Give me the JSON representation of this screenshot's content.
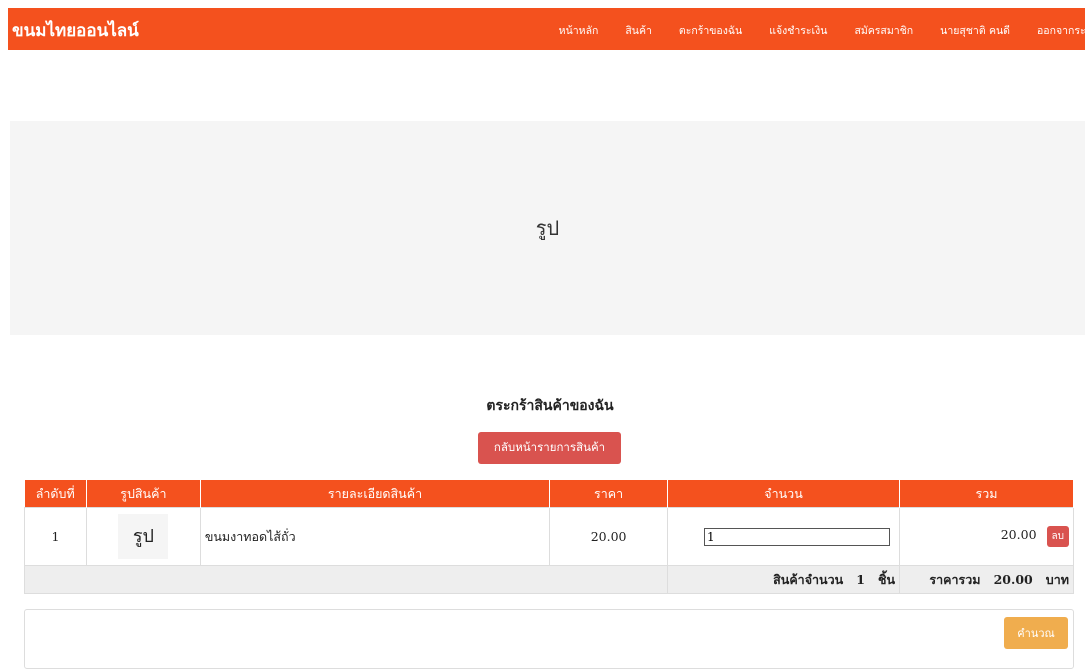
{
  "navbar": {
    "brand": "ขนมไทยออนไลน์",
    "links": [
      "หน้าหลัก",
      "สินค้า",
      "ตะกร้าของฉัน",
      "แจ้งชำระเงิน",
      "สมัครสมาชิก",
      "นายสุชาติ คนดี",
      "ออกจากระบบ"
    ]
  },
  "banner": {
    "placeholder": "รูป"
  },
  "cart": {
    "title": "ตระกร้าสินค้าของฉัน",
    "back_button": "กลับหน้ารายการสินค้า",
    "columns": [
      "ลำดับที่",
      "รูปสินค้า",
      "รายละเอียดสินค้า",
      "ราคา",
      "จำนวน",
      "รวม"
    ],
    "items": [
      {
        "index": "1",
        "image_placeholder": "รูป",
        "description": "ขนมงาทอดไส้ถั่ว",
        "price": "20.00",
        "quantity": "1",
        "total": "20.00",
        "delete_label": "ลบ"
      }
    ],
    "summary": {
      "qty_label": "สินค้าจำนวน",
      "qty_value": "1",
      "qty_unit": "ชิ้น",
      "total_label": "ราคารวม",
      "total_value": "20.00",
      "total_unit": "บาท"
    },
    "calculate_button": "คำนวณ"
  },
  "colors": {
    "primary": "#f4511e",
    "danger": "#d9534f",
    "warning": "#f0ad4e",
    "banner_bg": "#f5f5f5"
  }
}
